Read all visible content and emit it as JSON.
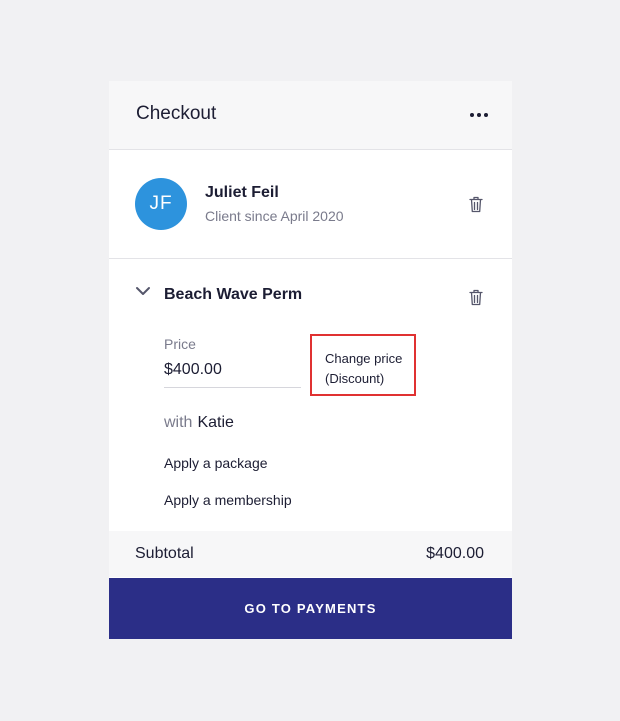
{
  "header": {
    "title": "Checkout",
    "more_icon": "more-horizontal-icon"
  },
  "client": {
    "initials": "JF",
    "name": "Juliet Feil",
    "subtitle": "Client since April 2020",
    "avatar_color": "#2d93dd"
  },
  "service": {
    "name": "Beach Wave Perm",
    "price_label": "Price",
    "price_value": "$400.00",
    "change_price_line1": "Change price",
    "change_price_line2": "(Discount)",
    "with_word": "with",
    "staff_name": "Katie",
    "apply_package": "Apply a package",
    "apply_membership": "Apply a membership"
  },
  "summary": {
    "subtotal_label": "Subtotal",
    "subtotal_value": "$400.00"
  },
  "actions": {
    "go_to_payments": "GO TO PAYMENTS"
  },
  "colors": {
    "primary": "#2b2e87",
    "highlight": "#e03131",
    "muted": "#7a7b8c"
  }
}
